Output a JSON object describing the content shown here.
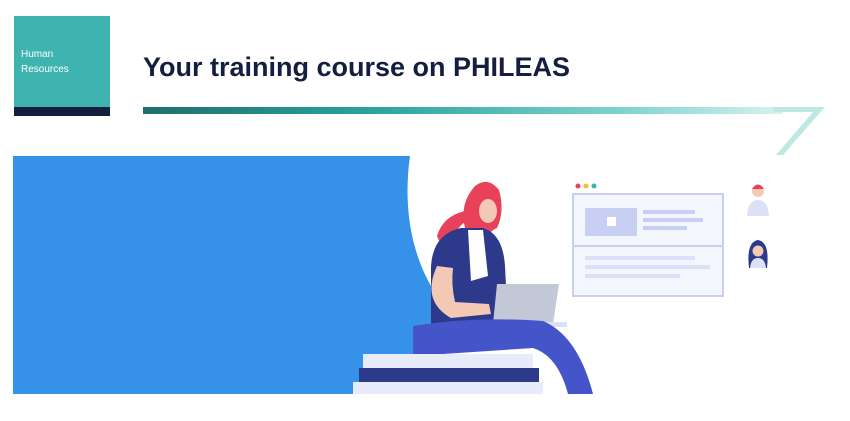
{
  "badge": {
    "line1": "Human",
    "line2": "Resources"
  },
  "page": {
    "title": "Your training course on PHILEAS"
  },
  "colors": {
    "teal": "#3fb3b0",
    "navy": "#141e40",
    "hero_blue": "#3592e8",
    "hair": "#e8415a"
  },
  "icons": {
    "avatar_male": "avatar-male-icon",
    "avatar_female": "avatar-female-icon",
    "video": "video-thumbnail-icon"
  }
}
